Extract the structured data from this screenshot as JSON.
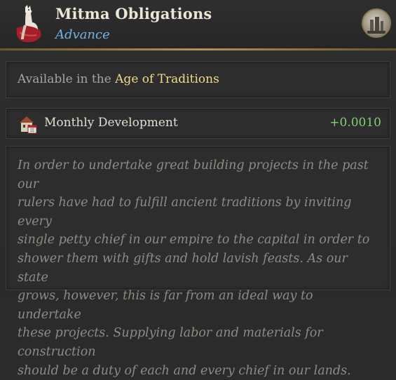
{
  "header": {
    "title": "Mitma Obligations",
    "subtitle": "Advance",
    "icon": "llama-icon",
    "medallion_icon": "age-of-traditions-icon"
  },
  "availability": {
    "prefix": "Available in the ",
    "age_name": "Age of Traditions"
  },
  "modifier": {
    "icon": "monthly-development-icon",
    "label": "Monthly Development",
    "value": "+0.0010"
  },
  "description": {
    "lines": [
      "In order to undertake great building projects in the past our",
      "rulers have had to fulfill ancient traditions by inviting every",
      "single petty chief in our empire to the capital in order to",
      "shower them with gifts and hold lavish feasts. As our state",
      "grows, however, this is far from an ideal way to undertake",
      "these projects. Supplying labor and materials for construction",
      "should be a duty of each and every chief in our lands."
    ]
  },
  "colors": {
    "title": "#ece6d6",
    "subtitle": "#6fb3e6",
    "age_highlight": "#f2d98c",
    "positive_value": "#7fd16f",
    "divider_gold": "#b39455"
  }
}
